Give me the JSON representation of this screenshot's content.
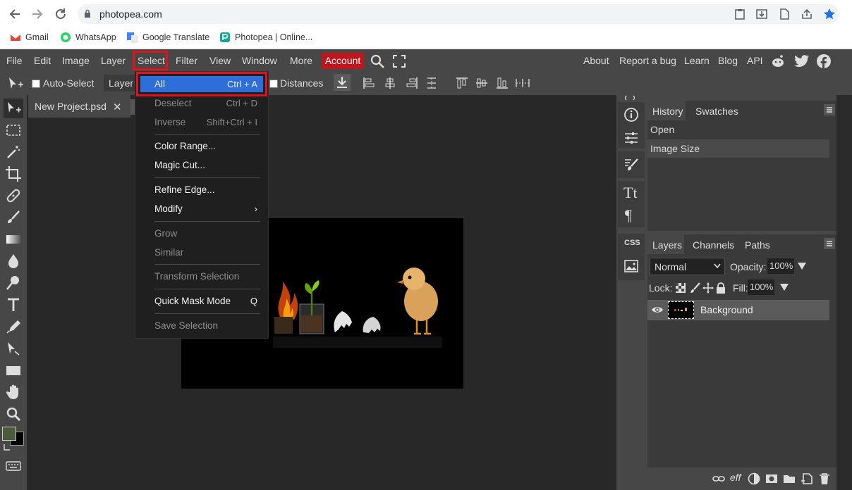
{
  "browser": {
    "url": "photopea.com",
    "bookmarks": [
      "Gmail",
      "WhatsApp",
      "Google Translate",
      "Photopea | Online..."
    ]
  },
  "menubar": {
    "items": [
      "File",
      "Edit",
      "Image",
      "Layer",
      "Select",
      "Filter",
      "View",
      "Window",
      "More"
    ],
    "account": "Account",
    "right_items": [
      "About",
      "Report a bug",
      "Learn",
      "Blog",
      "API"
    ]
  },
  "options": {
    "auto_select": "Auto-Select",
    "layer_dropdown": "Layer",
    "distances": "Distances"
  },
  "document": {
    "tab_title": "New Project.psd",
    "close_glyph": "✕"
  },
  "select_menu": {
    "items": [
      {
        "label": "All",
        "shortcut": "Ctrl + A",
        "enabled": true,
        "highlighted": true
      },
      {
        "label": "Deselect",
        "shortcut": "Ctrl + D",
        "enabled": false
      },
      {
        "label": "Inverse",
        "shortcut": "Shift+Ctrl + I",
        "enabled": false
      },
      {
        "label": "Color Range...",
        "shortcut": "",
        "enabled": true
      },
      {
        "label": "Magic Cut...",
        "shortcut": "",
        "enabled": true
      },
      {
        "label": "Refine Edge...",
        "shortcut": "",
        "enabled": true
      },
      {
        "label": "Modify",
        "shortcut": "›",
        "enabled": true
      },
      {
        "label": "Grow",
        "shortcut": "",
        "enabled": false
      },
      {
        "label": "Similar",
        "shortcut": "",
        "enabled": false
      },
      {
        "label": "Transform Selection",
        "shortcut": "",
        "enabled": false
      },
      {
        "label": "Quick Mask Mode",
        "shortcut": "Q",
        "enabled": true
      },
      {
        "label": "Save Selection",
        "shortcut": "",
        "enabled": false
      }
    ]
  },
  "history_panel": {
    "tabs": [
      "History",
      "Swatches"
    ],
    "entries": [
      "Open",
      "Image Size"
    ]
  },
  "layers_panel": {
    "tabs": [
      "Layers",
      "Channels",
      "Paths"
    ],
    "blend_mode": "Normal",
    "opacity_label": "Opacity:",
    "opacity": "100%",
    "lock_label": "Lock:",
    "fill_label": "Fill:",
    "fill": "100%",
    "layers": [
      "Background"
    ],
    "footer_eff": "eff"
  },
  "icon_column": {
    "css_label": "CSS",
    "type_glyph": "Tt",
    "para_glyph": "¶"
  },
  "colors": {
    "accent_red": "#e0131c",
    "account_red": "#c0151d",
    "highlight_blue": "#2d6ed8",
    "foreground_swatch": "#4a5a3a",
    "background_swatch": "#000000"
  }
}
